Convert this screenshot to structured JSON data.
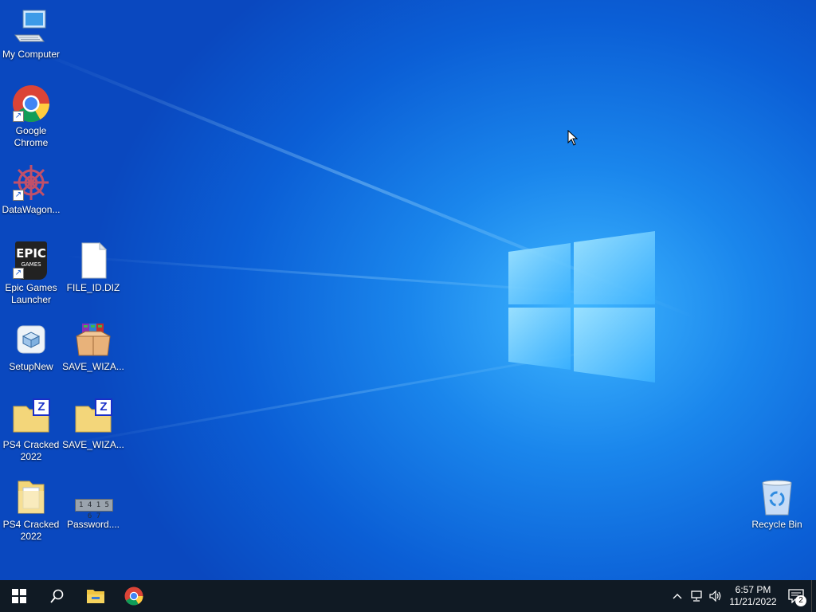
{
  "desktop": {
    "icons": [
      {
        "label": "My Computer",
        "icon": "computer-icon",
        "shortcut": false
      },
      {
        "label": "Google Chrome",
        "icon": "chrome-icon",
        "shortcut": true
      },
      {
        "label": "DataWagon...",
        "icon": "datawagon-icon",
        "shortcut": true
      },
      {
        "label": "Epic Games Launcher",
        "icon": "epic-games-icon",
        "shortcut": true,
        "badge_text": "EPIC",
        "badge_sub": "GAMES"
      },
      {
        "label": "FILE_ID.DIZ",
        "icon": "file-icon",
        "shortcut": false
      },
      {
        "label": "SetupNew",
        "icon": "setup-icon",
        "shortcut": false
      },
      {
        "label": "SAVE_WIZA...",
        "icon": "winrar-archive-icon",
        "shortcut": false
      },
      {
        "label": "PS4 Cracked 2022",
        "icon": "zip-folder-icon",
        "shortcut": false,
        "badge_text": "Z"
      },
      {
        "label": "SAVE_WIZA...",
        "icon": "zip-folder-icon",
        "shortcut": false,
        "badge_text": "Z"
      },
      {
        "label": "PS4 Cracked 2022",
        "icon": "folder-icon",
        "shortcut": false
      },
      {
        "label": "Password....",
        "icon": "password-file-icon",
        "shortcut": false,
        "badge_text": "1 4 1 5 6 7"
      },
      {
        "label": "Recycle Bin",
        "icon": "recycle-bin-icon",
        "shortcut": false
      }
    ]
  },
  "taskbar": {
    "start": "windows-start-icon",
    "search": "search-icon",
    "pinned": [
      "file-explorer-icon",
      "chrome-icon"
    ],
    "tray": {
      "chevron": "^",
      "icons": [
        "network-icon",
        "volume-icon"
      ],
      "time": "6:57 PM",
      "date": "11/21/2022",
      "notifications": "2"
    }
  },
  "colors": {
    "accent": "#1a86ec",
    "taskbar": "#101a24",
    "folder": "#f3d67a"
  }
}
